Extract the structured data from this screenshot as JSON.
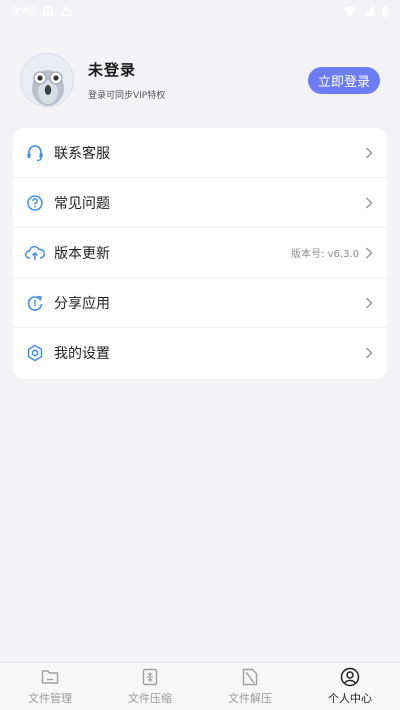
{
  "status_bar": {
    "time": "8:40"
  },
  "profile": {
    "name": "未登录",
    "subtitle": "登录可同步VIP特权",
    "login_button": "立即登录"
  },
  "menu": {
    "items": [
      {
        "label": "联系客服",
        "icon": "headset-icon",
        "value": ""
      },
      {
        "label": "常见问题",
        "icon": "question-circle-icon",
        "value": ""
      },
      {
        "label": "版本更新",
        "icon": "cloud-upload-icon",
        "value": "版本号: v6.3.0"
      },
      {
        "label": "分享应用",
        "icon": "share-refresh-icon",
        "value": ""
      },
      {
        "label": "我的设置",
        "icon": "gear-icon",
        "value": ""
      }
    ]
  },
  "bottom_nav": {
    "tabs": [
      {
        "label": "文件管理",
        "icon": "folder-icon",
        "active": false
      },
      {
        "label": "文件压缩",
        "icon": "compress-icon",
        "active": false
      },
      {
        "label": "文件解压",
        "icon": "extract-icon",
        "active": false
      },
      {
        "label": "个人中心",
        "icon": "user-icon",
        "active": true
      }
    ]
  },
  "colors": {
    "accent": "#6c7cf2",
    "icon_blue": "#3f8fe8",
    "background": "#f3f3f5"
  }
}
